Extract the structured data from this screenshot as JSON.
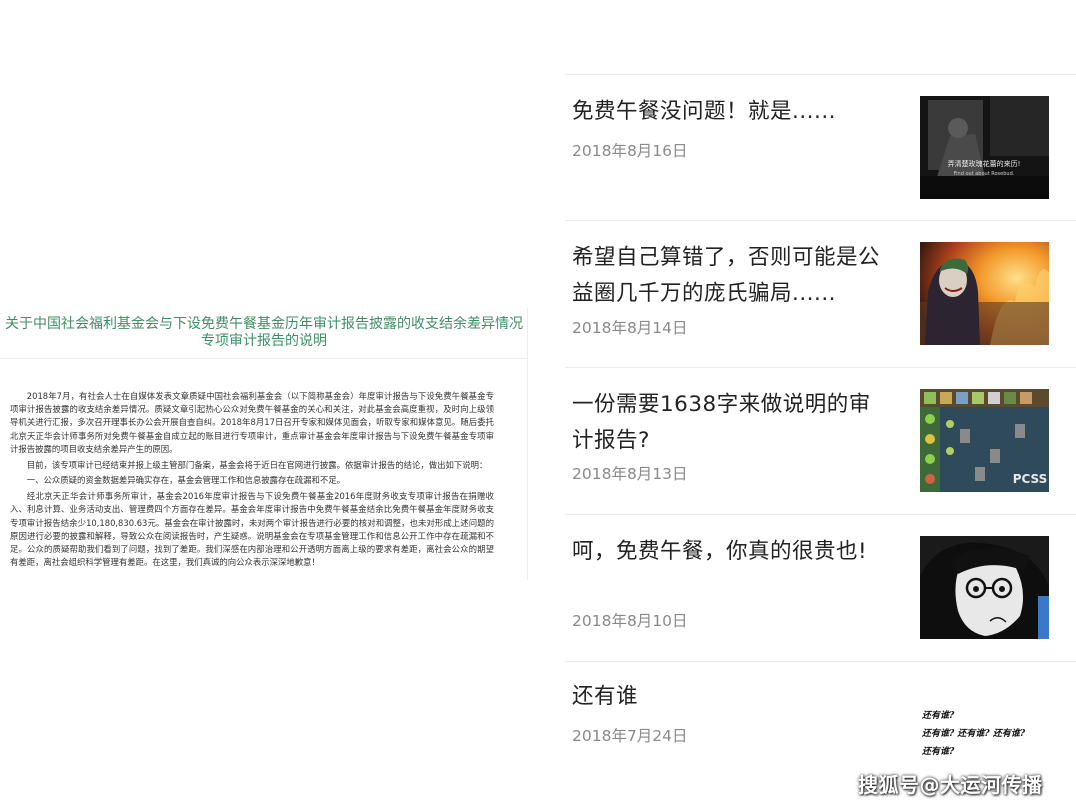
{
  "document": {
    "title_line1": "关于中国社会福利基金会与下设免费午餐基金历年审计报告披露的收支结余差异情况",
    "title_line2": "专项审计报告的说明",
    "paragraphs": [
      "2018年7月，有社会人士在自媒体发表文章质疑中国社会福利基金会（以下简称基金会）年度审计报告与下设免费午餐基金专项审计报告披露的收支结余差异情况。质疑文章引起热心公众对免费午餐基金的关心和关注，对此基金会高度重视，及时向上级领导机关进行汇报，多次召开理事长办公会开展自查自纠。2018年8月17日召开专家和媒体见面会，听取专家和媒体意见。随后委托北京天正华会计师事务所对免费午餐基金自成立起的账目进行专项审计，重点审计基金会年度审计报告与下设免费午餐基金专项审计报告披露的项目收支结余差异产生的原因。",
      "目前，该专项审计已经结束并报上级主管部门备案，基金会将于近日在官网进行披露。依据审计报告的结论，做出如下说明：",
      "一、公众质疑的资金数据差异确实存在，基金会管理工作和信息披露存在疏漏和不足。",
      "经北京天正华会计师事务所审计，基金会2016年度审计报告与下设免费午餐基金2016年度财务收支专项审计报告在捐赠收入、利息计算、业务活动支出、管理费四个方面存在差异。基金会年度审计报告中免费午餐基金结余比免费午餐基金年度财务收支专项审计报告结余少10,180,830.63元。基金会在审计披露时，未对两个审计报告进行必要的核对和调整，也未对形成上述问题的原因进行必要的披露和解释，导致公众在阅读报告时，产生疑惑。说明基金会在专项基金管理工作和信息公开工作中存在疏漏和不足。公众的质疑帮助我们看到了问题，找到了差距。我们深感在内部治理和公开透明方面离上级的要求有差距，离社会公众的期望有差距，离社会组织科学管理有差距。在这里，我们真诚的向公众表示深深地歉意！"
    ]
  },
  "articles": [
    {
      "title": "免费午餐没问题！就是......",
      "date": "2018年8月16日",
      "thumb_caption_cn": "弄清楚玫瑰花蕾的来历!",
      "thumb_caption_en": "Find out about Rosebud."
    },
    {
      "title": "希望自己算错了，否则可能是公益圈几千万的庞氏骗局......",
      "date": "2018年8月14日"
    },
    {
      "title": "一份需要1638字来做说明的审计报告?",
      "date": "2018年8月13日",
      "thumb_text": "PCSS"
    },
    {
      "title": "呵，免费午餐，你真的很贵也!",
      "date": "2018年8月10日"
    },
    {
      "title": "还有谁",
      "date": "2018年7月24日",
      "thumb_lines": [
        "还有谁?",
        "还有谁? 还有谁? 还有谁?",
        "还有谁?"
      ]
    }
  ],
  "watermark": "搜狐号@大运河传播",
  "colors": {
    "doc_title": "#3f8f63",
    "date": "#8a8a8a",
    "title": "#222222"
  }
}
